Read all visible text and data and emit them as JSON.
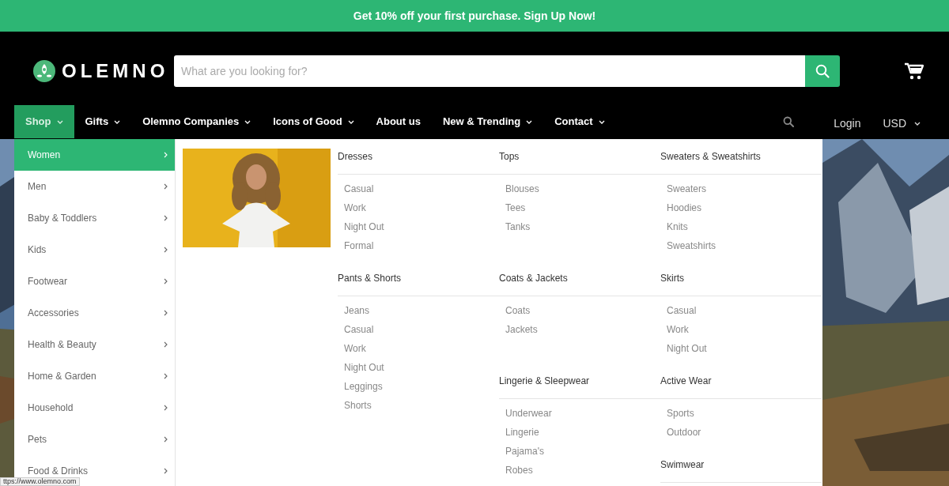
{
  "banner": {
    "text": "Get 10% off your first purchase. Sign Up Now!"
  },
  "logo": {
    "text": "OLEMNO"
  },
  "search": {
    "placeholder": "What are you looking for?"
  },
  "nav": [
    {
      "label": "Shop",
      "dropdown": true,
      "selected": true
    },
    {
      "label": "Gifts",
      "dropdown": true,
      "selected": false
    },
    {
      "label": "Olemno Companies",
      "dropdown": true,
      "selected": false
    },
    {
      "label": "Icons of Good",
      "dropdown": true,
      "selected": false
    },
    {
      "label": "About us",
      "dropdown": false,
      "selected": false
    },
    {
      "label": "New & Trending",
      "dropdown": true,
      "selected": false
    },
    {
      "label": "Contact",
      "dropdown": true,
      "selected": false
    }
  ],
  "account": {
    "login": "Login",
    "currency": "USD"
  },
  "categories": [
    {
      "label": "Women",
      "selected": true
    },
    {
      "label": "Men",
      "selected": false
    },
    {
      "label": "Baby & Toddlers",
      "selected": false
    },
    {
      "label": "Kids",
      "selected": false
    },
    {
      "label": "Footwear",
      "selected": false
    },
    {
      "label": "Accessories",
      "selected": false
    },
    {
      "label": "Health & Beauty",
      "selected": false
    },
    {
      "label": "Home & Garden",
      "selected": false
    },
    {
      "label": "Household",
      "selected": false
    },
    {
      "label": "Pets",
      "selected": false
    },
    {
      "label": "Food & Drinks",
      "selected": false
    }
  ],
  "menu_columns": [
    [
      {
        "heading": "Dresses",
        "items": [
          "Casual",
          "Work",
          "Night Out",
          "Formal"
        ]
      },
      {
        "heading": "Pants & Shorts",
        "items": [
          "Jeans",
          "Casual",
          "Work",
          "Night Out",
          "Leggings",
          "Shorts"
        ]
      }
    ],
    [
      {
        "heading": "Tops",
        "items": [
          "Blouses",
          "Tees",
          "Tanks"
        ]
      },
      {
        "heading": "Coats & Jackets",
        "items": [
          "Coats",
          "Jackets"
        ]
      },
      {
        "heading": "Lingerie & Sleepwear",
        "items": [
          "Underwear",
          "Lingerie",
          "Pajama's",
          "Robes"
        ]
      }
    ],
    [
      {
        "heading": "Sweaters & Sweatshirts",
        "items": [
          "Sweaters",
          "Hoodies",
          "Knits",
          "Sweatshirts"
        ]
      },
      {
        "heading": "Skirts",
        "items": [
          "Casual",
          "Work",
          "Night Out"
        ]
      },
      {
        "heading": "Active Wear",
        "items": [
          "Sports",
          "Outdoor"
        ]
      },
      {
        "heading": "Swimwear"
      }
    ]
  ],
  "status_url": "ttps://www.olemno.com"
}
